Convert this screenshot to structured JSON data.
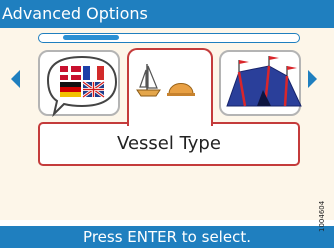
{
  "title": "Advanced Options",
  "scroll": {
    "position": 0.12
  },
  "carousel": {
    "items": [
      {
        "name": "Languages",
        "icon": "language-flags-icon"
      },
      {
        "name": "Vessel Type",
        "icon": "vessel-type-icon"
      },
      {
        "name": "Event",
        "icon": "circus-tent-icon"
      }
    ],
    "selected_label": "Vessel Type"
  },
  "footer": {
    "hint": "Press ENTER to select."
  },
  "doc_id": "1004604",
  "colors": {
    "accent": "#1f7fbf",
    "selection": "#c43b3b",
    "background": "#fdf6e9"
  }
}
